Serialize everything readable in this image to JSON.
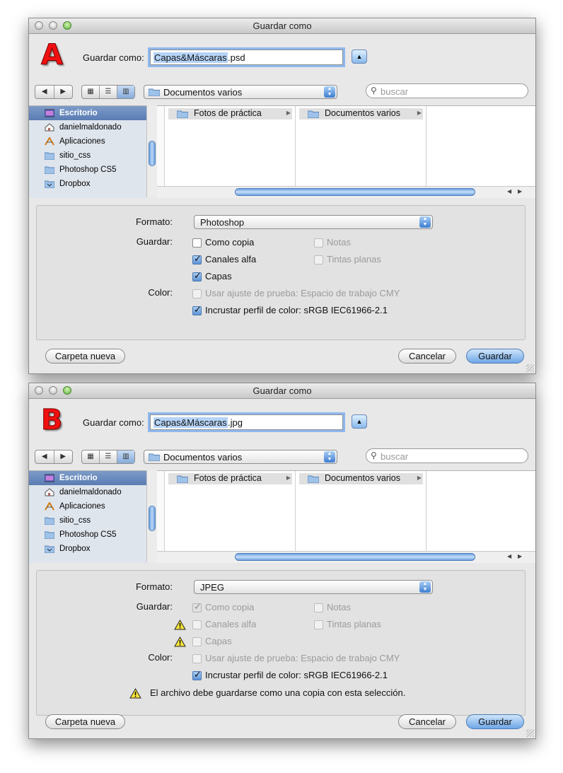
{
  "dialogs": [
    {
      "id": "A",
      "window_title": "Guardar como",
      "badge_letter": "A",
      "save_as_label": "Guardar como:",
      "filename_selected": "Capas&Máscaras",
      "filename_ext": ".psd",
      "location": "Documentos varios",
      "search_placeholder": "buscar",
      "sidebar": [
        "Escritorio",
        "danielmaldonado",
        "Aplicaciones",
        "sitio_css",
        "Photoshop CS5",
        "Dropbox"
      ],
      "columns": [
        "Fotos de práctica",
        "Documentos varios"
      ],
      "format_label": "Formato:",
      "format_value": "Photoshop",
      "save_label": "Guardar:",
      "color_label": "Color:",
      "options": [
        {
          "label": "Como copia",
          "checked": false,
          "enabled": true,
          "warning": false
        },
        {
          "label": "Notas",
          "checked": false,
          "enabled": false,
          "warning": false
        },
        {
          "label": "Canales alfa",
          "checked": true,
          "enabled": true,
          "warning": false
        },
        {
          "label": "Tintas planas",
          "checked": false,
          "enabled": false,
          "warning": false
        },
        {
          "label": "Capas",
          "checked": true,
          "enabled": true,
          "warning": false
        },
        {
          "label": "Usar ajuste de prueba: Espacio de trabajo CMY",
          "checked": false,
          "enabled": false,
          "warning": false
        },
        {
          "label": "Incrustar perfil de color: sRGB IEC61966-2.1",
          "checked": true,
          "enabled": true,
          "warning": false
        }
      ],
      "warning_message": "",
      "new_folder_button": "Carpeta nueva",
      "cancel_button": "Cancelar",
      "save_button": "Guardar"
    },
    {
      "id": "B",
      "window_title": "Guardar como",
      "badge_letter": "B",
      "save_as_label": "Guardar como:",
      "filename_selected": "Capas&Máscaras",
      "filename_ext": ".jpg",
      "location": "Documentos varios",
      "search_placeholder": "buscar",
      "sidebar": [
        "Escritorio",
        "danielmaldonado",
        "Aplicaciones",
        "sitio_css",
        "Photoshop CS5",
        "Dropbox"
      ],
      "columns": [
        "Fotos de práctica",
        "Documentos varios"
      ],
      "format_label": "Formato:",
      "format_value": "JPEG",
      "save_label": "Guardar:",
      "color_label": "Color:",
      "options": [
        {
          "label": "Como copia",
          "checked": true,
          "enabled": false,
          "warning": false
        },
        {
          "label": "Notas",
          "checked": false,
          "enabled": false,
          "warning": false
        },
        {
          "label": "Canales alfa",
          "checked": false,
          "enabled": false,
          "warning": true
        },
        {
          "label": "Tintas planas",
          "checked": false,
          "enabled": false,
          "warning": false
        },
        {
          "label": "Capas",
          "checked": false,
          "enabled": false,
          "warning": true
        },
        {
          "label": "Usar ajuste de prueba: Espacio de trabajo CMY",
          "checked": false,
          "enabled": false,
          "warning": false
        },
        {
          "label": "Incrustar perfil de color: sRGB IEC61966-2.1",
          "checked": true,
          "enabled": true,
          "warning": false
        }
      ],
      "warning_message": "El archivo debe guardarse como una copia con esta selección.",
      "new_folder_button": "Carpeta nueva",
      "cancel_button": "Cancelar",
      "save_button": "Guardar"
    }
  ],
  "colors": {
    "badge_red": "#f01010",
    "selection_blue": "#b5d3f6",
    "accent_blue": "#6ea6e8"
  },
  "icons": {
    "back": "chevron-left-icon",
    "forward": "chevron-right-icon",
    "icon_view": "grid-icon",
    "list_view": "list-icon",
    "column_view": "columns-icon",
    "search": "magnifier-icon",
    "folder": "folder-icon",
    "warning": "warning-icon"
  }
}
